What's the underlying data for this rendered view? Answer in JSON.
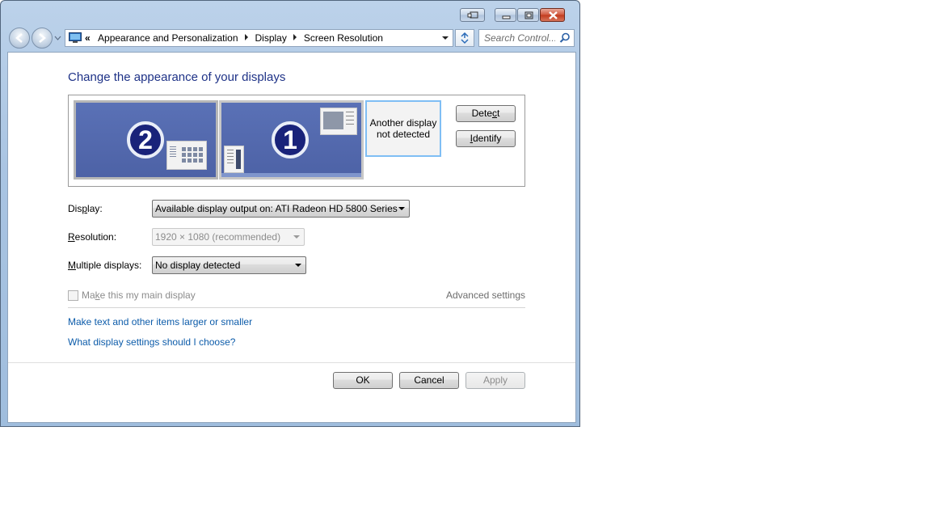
{
  "window": {
    "caption_buttons": [
      "minimize",
      "maximize",
      "close"
    ]
  },
  "address_bar": {
    "overflow": "«",
    "crumbs": [
      "Appearance and Personalization",
      "Display",
      "Screen Resolution"
    ]
  },
  "search": {
    "placeholder": "Search Control..."
  },
  "main": {
    "heading": "Change the appearance of your displays",
    "monitors": {
      "monitor_2_number": "2",
      "monitor_1_number": "1",
      "not_detected_text_line1": "Another display",
      "not_detected_text_line2": "not detected"
    },
    "detect_button_label_pre": "Dete",
    "detect_button_label_ul": "c",
    "detect_button_label_post": "t",
    "identify_button_label_ul": "I",
    "identify_button_label_post": "dentify",
    "display_label_pre": "Dis",
    "display_label_ul": "p",
    "display_label_post": "lay:",
    "display_value": "Available display output on: ATI Radeon HD 5800 Series",
    "resolution_label_ul": "R",
    "resolution_label_post": "esolution:",
    "resolution_value": "1920 × 1080 (recommended)",
    "multiple_label_ul": "M",
    "multiple_label_post": "ultiple displays:",
    "multiple_value": "No display detected",
    "main_display_checkbox_pre": "Ma",
    "main_display_checkbox_ul": "k",
    "main_display_checkbox_post": "e this my main display",
    "main_display_checked": false,
    "advanced_link": "Advanced settings",
    "link_text_size": "Make text and other items larger or smaller",
    "link_help": "What display settings should I choose?"
  },
  "footer": {
    "ok_label": "OK",
    "cancel_label": "Cancel",
    "apply_label": "Apply"
  },
  "colors": {
    "heading": "#1e3287",
    "link": "#0d5caa",
    "monitor_fill": "#5a71b6",
    "badge": "#19237a"
  }
}
